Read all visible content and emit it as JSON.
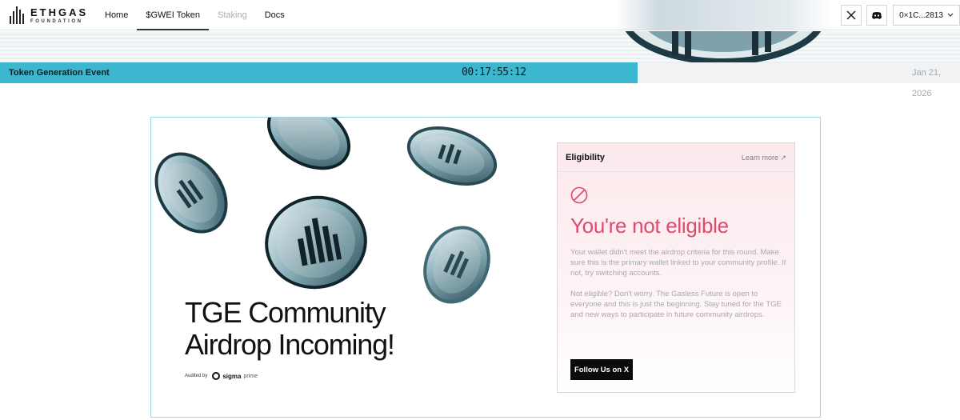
{
  "header": {
    "logo_title": "ETHGAS",
    "logo_subtitle": "FOUNDATION",
    "nav": [
      {
        "label": "Home",
        "state": "normal"
      },
      {
        "label": "$GWEI Token",
        "state": "active"
      },
      {
        "label": "Staking",
        "state": "disabled"
      },
      {
        "label": "Docs",
        "state": "normal"
      }
    ],
    "x_icon": "x-logo-icon",
    "discord_icon": "discord-icon",
    "wallet_label": "0×1C...2813",
    "wallet_chevron": "chevron-down-icon"
  },
  "tge": {
    "label": "Token Generation Event",
    "countdown": "00:17:55:12",
    "date": "Jan 21, 2026",
    "progress": 0.664,
    "accent_color": "#3db7cf"
  },
  "hero": {
    "title_line1": "TGE Community",
    "title_line2": "Airdrop Incoming!",
    "audited_by": "Audited by",
    "auditor_name": "sigma",
    "auditor_suffix": "prime"
  },
  "eligibility": {
    "title": "Eligibility",
    "learn_more": "Learn more ↗",
    "status_icon": "ban-icon",
    "status_title": "You're not eligible",
    "status_color": "#df4a6a",
    "message1": "Your wallet didn't meet the airdrop criteria for this round. Make sure this is the primary wallet linked to your community profile. If not, try switching accounts.",
    "message2": "Not eligible? Don't worry. The Gasless Future is open to everyone and this is just the beginning. Stay tuned for the TGE and new ways to participate in future community airdrops.",
    "cta": "Follow Us on X"
  }
}
